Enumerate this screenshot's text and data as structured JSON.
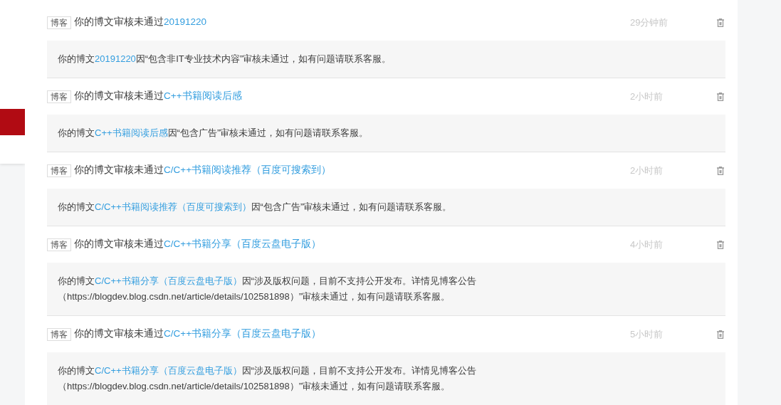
{
  "sidebar": {
    "items": [
      {
        "selected": false
      },
      {
        "selected": true
      },
      {
        "selected": false
      }
    ]
  },
  "messages": [
    {
      "tag": "博客",
      "title": "你的博文审核未通过",
      "title_link": "20191220",
      "time": "29分钟前",
      "detail": {
        "before": "你的博文",
        "link": "20191220",
        "after": "因“包含非IT专业技术内容”审核未通过，如有问题请联系客服。"
      }
    },
    {
      "tag": "博客",
      "title": "你的博文审核未通过",
      "title_link": "C++书籍阅读后感",
      "time": "2小时前",
      "detail": {
        "before": "你的博文",
        "link": "C++书籍阅读后感",
        "after": "因“包含广告”审核未通过，如有问题请联系客服。"
      }
    },
    {
      "tag": "博客",
      "title": "你的博文审核未通过",
      "title_link": "C/C++书籍阅读推荐（百度可搜索到）",
      "time": "2小时前",
      "detail": {
        "before": "你的博文",
        "link": "C/C++书籍阅读推荐（百度可搜索到）",
        "after": "因“包含广告”审核未通过，如有问题请联系客服。"
      }
    },
    {
      "tag": "博客",
      "title": "你的博文审核未通过",
      "title_link": "C/C++书籍分享（百度云盘电子版）",
      "time": "4小时前",
      "detail": {
        "before": "你的博文",
        "link": "C/C++书籍分享（百度云盘电子版）",
        "after": "因“涉及版权问题，目前不支持公开发布。详情见博客公告（https://blogdev.blog.csdn.net/article/details/102581898）”审核未通过，如有问题请联系客服。"
      }
    },
    {
      "tag": "博客",
      "title": "你的博文审核未通过",
      "title_link": "C/C++书籍分享（百度云盘电子版）",
      "time": "5小时前",
      "detail": {
        "before": "你的博文",
        "link": "C/C++书籍分享（百度云盘电子版）",
        "after": "因“涉及版权问题，目前不支持公开发布。详情见博客公告（https://blogdev.blog.csdn.net/article/details/102581898）”审核未通过，如有问题请联系客服。"
      }
    }
  ]
}
